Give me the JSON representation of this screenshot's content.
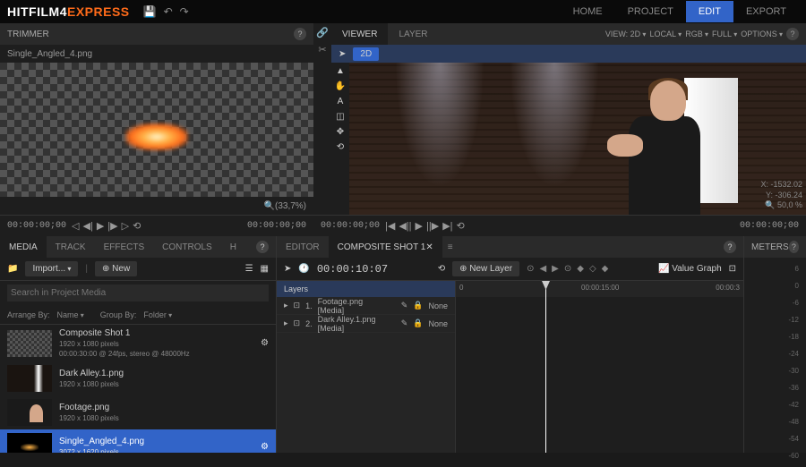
{
  "app": {
    "name1": "HITFILM4",
    "name2": "EXPRESS"
  },
  "nav": {
    "home": "HOME",
    "project": "PROJECT",
    "edit": "EDIT",
    "export": "EXPORT"
  },
  "trimmer": {
    "title": "TRIMMER",
    "filename": "Single_Angled_4.png",
    "zoom": "(33,7%)",
    "timecode_left": "00:00:00;00",
    "timecode_right": "00:00:00;00"
  },
  "viewer": {
    "tabs": {
      "viewer": "VIEWER",
      "layer": "LAYER"
    },
    "mode": "2D",
    "opts": {
      "view": "VIEW: 2D",
      "local": "LOCAL",
      "rgb": "RGB",
      "full": "FULL",
      "options": "OPTIONS"
    },
    "coords": {
      "x_label": "X:",
      "x": "-1532.02",
      "y_label": "Y:",
      "y": "-306.24",
      "zoom": "50,0 %"
    },
    "timecode_left": "00:00:00;00",
    "timecode_right": "00:00:00;00"
  },
  "media": {
    "tabs": {
      "media": "MEDIA",
      "track": "TRACK",
      "effects": "EFFECTS",
      "controls": "CONTROLS",
      "h": "H"
    },
    "import": "Import...",
    "new": "New",
    "search": "Search in Project Media",
    "arrange_label": "Arrange By:",
    "arrange_val": "Name",
    "group_label": "Group By:",
    "group_val": "Folder",
    "items": [
      {
        "name": "Composite Shot 1",
        "meta1": "1920 x 1080 pixels",
        "meta2": "00:00:30:00 @ 24fps, stereo @ 48000Hz"
      },
      {
        "name": "Dark Alley.1.png",
        "meta1": "1920 x 1080 pixels",
        "meta2": ""
      },
      {
        "name": "Footage.png",
        "meta1": "1920 x 1080 pixels",
        "meta2": ""
      },
      {
        "name": "Single_Angled_4.png",
        "meta1": "3072 x 1620 pixels",
        "meta2": ""
      }
    ]
  },
  "timeline": {
    "tabs": {
      "editor": "EDITOR",
      "comp": "COMPOSITE SHOT 1"
    },
    "timecode": "00:00:10:07",
    "new_layer": "New Layer",
    "value_graph": "Value Graph",
    "layers_label": "Layers",
    "layers": [
      {
        "idx": "1.",
        "name": "Footage.png [Media]",
        "mode": "None"
      },
      {
        "idx": "2.",
        "name": "Dark Alley.1.png [Media]",
        "mode": "None"
      }
    ],
    "ruler": {
      "t0": "0",
      "t1": "00:00:15:00",
      "t2": "00:00:3"
    }
  },
  "meters": {
    "title": "METERS",
    "scale": [
      "6",
      "0",
      "-6",
      "-12",
      "-18",
      "-24",
      "-30",
      "-36",
      "-42",
      "-48",
      "-54",
      "-60"
    ]
  }
}
